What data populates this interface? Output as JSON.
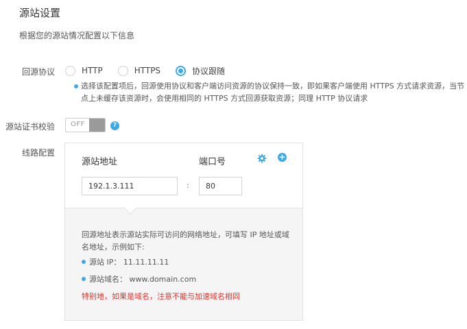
{
  "page": {
    "title": "源站设置",
    "subtitle": "根据您的源站情况配置以下信息"
  },
  "protocol": {
    "label": "回源协议",
    "options": [
      {
        "label": "HTTP",
        "checked": false
      },
      {
        "label": "HTTPS",
        "checked": false
      },
      {
        "label": "协议跟随",
        "checked": true
      }
    ],
    "note": "选择该配置项后，回源使用协议和客户端访问资源的协议保持一致，即如果客户端使用 HTTPS 方式请求资源，当节点上未缓存该资源时，会使用相同的 HTTPS 方式回源获取资源；同理 HTTP 协议请求"
  },
  "cert": {
    "label": "源站证书校验",
    "toggle_text": "OFF",
    "toggle_on": false,
    "help_symbol": "?"
  },
  "route": {
    "label": "线路配置",
    "col_address": "源站地址",
    "col_port": "端口号",
    "address_value": "192.1.3.111",
    "separator": ":",
    "port_value": "80",
    "add_symbol": "+",
    "info_text": "回源地址表示源站实际可访问的网络地址，可填写 IP 地址或域名地址，示例如下:",
    "example_ip": "源站 IP： 11.11.11.11",
    "example_domain": "源站域名： www.domain.com",
    "warning": "特别地，如果是域名，注意不能与加速域名相同"
  },
  "colors": {
    "accent": "#3da8e8",
    "warning": "#e0322d"
  }
}
